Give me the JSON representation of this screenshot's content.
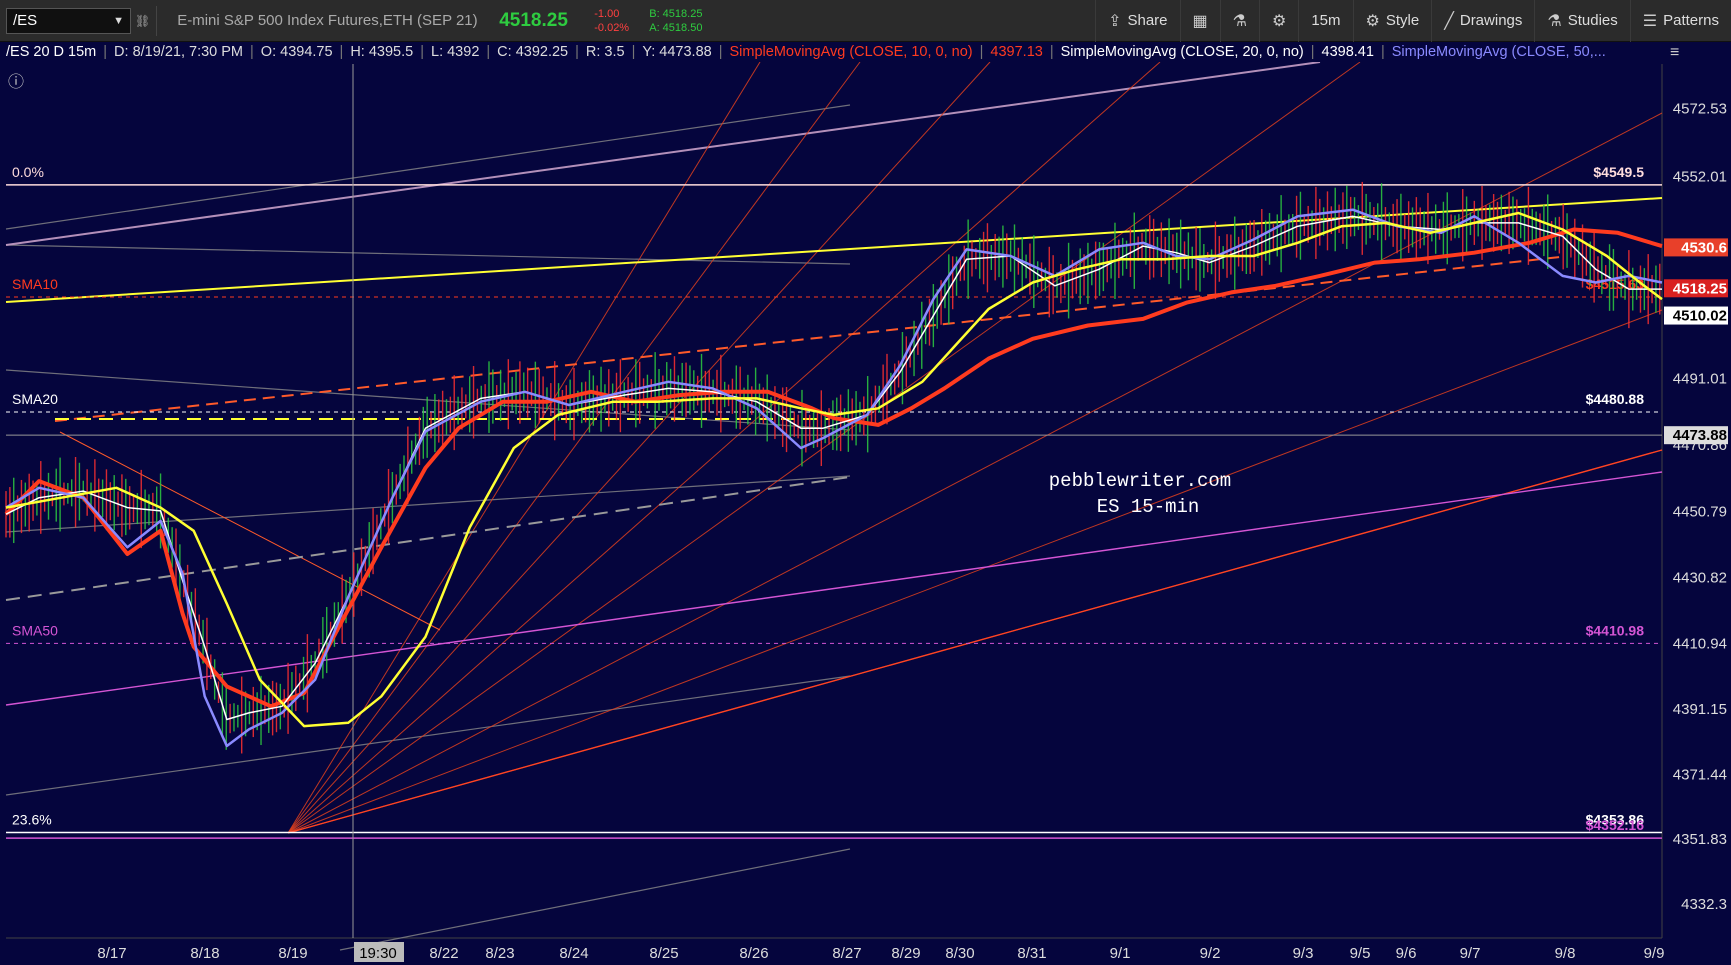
{
  "toolbar": {
    "symbol": "/ES",
    "description": "E-mini S&P 500 Index Futures,ETH (SEP 21)",
    "last": "4518.25",
    "change": "-1.00",
    "change_pct": "-0.02%",
    "bid": "B: 4518.25",
    "ask": "A: 4518.50",
    "share_label": "Share",
    "timeframe_label": "15m",
    "style_label": "Style",
    "drawings_label": "Drawings",
    "studies_label": "Studies",
    "patterns_label": "Patterns"
  },
  "info": {
    "chart_id": "/ES 20 D 15m",
    "date": "D: 8/19/21, 7:30 PM",
    "open": "O: 4394.75",
    "high": "H: 4395.5",
    "low": "L: 4392",
    "close": "C: 4392.25",
    "range": "R: 3.5",
    "cursor_y": "Y: 4473.88",
    "sma10_label": "SimpleMovingAvg (CLOSE, 10, 0, no)",
    "sma10_value": "4397.13",
    "sma20_label": "SimpleMovingAvg (CLOSE, 20, 0, no)",
    "sma20_value": "4398.41",
    "sma50_label": "SimpleMovingAvg (CLOSE, 50,..."
  },
  "colors": {
    "background": "#05053d",
    "sma10": "#ff3b1f",
    "sma20": "#ffffff",
    "sma50": "#8a8aff",
    "yellow": "#ffff33",
    "magenta": "#d455d4",
    "up": "#2ecc40",
    "down": "#ff3030"
  },
  "chart_data": {
    "type": "line",
    "watermark": [
      "pebblewriter.com",
      "ES 15-min"
    ],
    "y_ticks": [
      "4572.53",
      "4552.01",
      "4530.6",
      "4518.25",
      "4510.02",
      "4491.01",
      "4473.88",
      "4470.86",
      "4450.79",
      "4430.82",
      "4410.94",
      "4391.15",
      "4371.44",
      "4351.83",
      "4332.3"
    ],
    "y_range": [
      4322,
      4586
    ],
    "x_ticks": [
      "8/17",
      "8/18",
      "8/19",
      "19:30",
      "8/22",
      "8/23",
      "8/24",
      "8/25",
      "8/26",
      "8/27",
      "8/29",
      "8/30",
      "8/31",
      "9/1",
      "9/2",
      "9/3",
      "9/5",
      "9/6",
      "9/7",
      "9/8",
      "9/9"
    ],
    "levels": [
      {
        "label_left": "0.0%",
        "label_right": "$4549.5",
        "value": 4549.5,
        "color": "#ffdddd",
        "dash": false
      },
      {
        "label_left": "SMA10",
        "label_right": "$4515.63",
        "value": 4515.63,
        "color": "#ff3b1f",
        "dash": true
      },
      {
        "label_left": "SMA20",
        "label_right": "$4480.88",
        "value": 4480.88,
        "color": "#ffffff",
        "dash": true
      },
      {
        "label_left": "SMA50",
        "label_right": "$4410.98",
        "value": 4410.98,
        "color": "#d455d4",
        "dash": true
      },
      {
        "label_left": "23.6%",
        "label_right": "$4353.86",
        "value": 4353.86,
        "color": "#ffffff",
        "dash": false
      },
      {
        "label_left": "",
        "label_right": "$4352.16",
        "value": 4352.16,
        "color": "#d455d4",
        "dash": false
      }
    ],
    "price_tags": [
      {
        "text": "4530.6",
        "value": 4530.6,
        "bg": "#e8402a",
        "fg": "#ffffff"
      },
      {
        "text": "4518.25",
        "value": 4518.25,
        "bg": "#d92020",
        "fg": "#ffffff"
      },
      {
        "text": "4510.02",
        "value": 4510.02,
        "bg": "#ffffff",
        "fg": "#000000"
      },
      {
        "text": "4473.88",
        "value": 4473.88,
        "bg": "#dddddd",
        "fg": "#000000"
      }
    ],
    "series": [
      {
        "name": "SMA10",
        "values": [
          [
            0,
            4450
          ],
          [
            3,
            4460
          ],
          [
            7,
            4455
          ],
          [
            11,
            4438
          ],
          [
            14,
            4445
          ],
          [
            16,
            4420
          ],
          [
            17,
            4410
          ],
          [
            20,
            4398
          ],
          [
            24,
            4392
          ],
          [
            27,
            4396
          ],
          [
            30,
            4415
          ],
          [
            34,
            4440
          ],
          [
            38,
            4464
          ],
          [
            41,
            4476
          ],
          [
            45,
            4484
          ],
          [
            49,
            4484
          ],
          [
            53,
            4487
          ],
          [
            57,
            4484
          ],
          [
            61,
            4486
          ],
          [
            65,
            4487
          ],
          [
            69,
            4487
          ],
          [
            73,
            4482
          ],
          [
            75,
            4479
          ],
          [
            79,
            4477
          ],
          [
            82,
            4482
          ],
          [
            85,
            4488
          ],
          [
            89,
            4497
          ],
          [
            93,
            4503
          ],
          [
            98,
            4507
          ],
          [
            103,
            4509
          ],
          [
            107,
            4514
          ],
          [
            111,
            4517
          ],
          [
            115,
            4519
          ],
          [
            119,
            4522
          ],
          [
            124,
            4526
          ],
          [
            128,
            4527
          ],
          [
            133,
            4529
          ],
          [
            138,
            4532
          ],
          [
            142,
            4536
          ],
          [
            146,
            4535
          ],
          [
            150,
            4531
          ]
        ]
      },
      {
        "name": "SMA20",
        "values": [
          [
            0,
            4450
          ],
          [
            3,
            4455
          ],
          [
            7,
            4457
          ],
          [
            11,
            4452
          ],
          [
            14,
            4451
          ],
          [
            16,
            4430
          ],
          [
            18,
            4410
          ],
          [
            20,
            4388
          ],
          [
            22,
            4390
          ],
          [
            25,
            4392
          ],
          [
            28,
            4405
          ],
          [
            31,
            4425
          ],
          [
            35,
            4455
          ],
          [
            38,
            4476
          ],
          [
            43,
            4485
          ],
          [
            47,
            4487
          ],
          [
            51,
            4483
          ],
          [
            56,
            4486
          ],
          [
            60,
            4488
          ],
          [
            64,
            4487
          ],
          [
            68,
            4484
          ],
          [
            72,
            4476
          ],
          [
            74,
            4476
          ],
          [
            78,
            4480
          ],
          [
            81,
            4493
          ],
          [
            84,
            4510
          ],
          [
            87,
            4527
          ],
          [
            91,
            4528
          ],
          [
            95,
            4519
          ],
          [
            99,
            4524
          ],
          [
            103,
            4531
          ],
          [
            106,
            4529
          ],
          [
            109,
            4526
          ],
          [
            113,
            4531
          ],
          [
            117,
            4537
          ],
          [
            122,
            4540
          ],
          [
            126,
            4537
          ],
          [
            130,
            4536
          ],
          [
            133,
            4538
          ],
          [
            137,
            4538
          ],
          [
            141,
            4534
          ],
          [
            144,
            4524
          ],
          [
            147,
            4518
          ],
          [
            150,
            4518
          ]
        ]
      },
      {
        "name": "SMA50",
        "values": [
          [
            0,
            4452
          ],
          [
            3,
            4458
          ],
          [
            7,
            4455
          ],
          [
            11,
            4440
          ],
          [
            14,
            4448
          ],
          [
            16,
            4432
          ],
          [
            18,
            4395
          ],
          [
            20,
            4380
          ],
          [
            22,
            4385
          ],
          [
            25,
            4390
          ],
          [
            28,
            4400
          ],
          [
            31,
            4425
          ],
          [
            35,
            4455
          ],
          [
            38,
            4475
          ],
          [
            43,
            4484
          ],
          [
            47,
            4487
          ],
          [
            51,
            4483
          ],
          [
            56,
            4487
          ],
          [
            60,
            4490
          ],
          [
            64,
            4488
          ],
          [
            68,
            4482
          ],
          [
            72,
            4470
          ],
          [
            74,
            4473
          ],
          [
            78,
            4480
          ],
          [
            81,
            4495
          ],
          [
            84,
            4515
          ],
          [
            87,
            4530
          ],
          [
            91,
            4528
          ],
          [
            95,
            4522
          ],
          [
            99,
            4530
          ],
          [
            103,
            4532
          ],
          [
            106,
            4528
          ],
          [
            109,
            4527
          ],
          [
            113,
            4533
          ],
          [
            117,
            4540
          ],
          [
            122,
            4542
          ],
          [
            126,
            4537
          ],
          [
            130,
            4535
          ],
          [
            133,
            4540
          ],
          [
            137,
            4532
          ],
          [
            141,
            4522
          ],
          [
            144,
            4520
          ],
          [
            147,
            4522
          ],
          [
            150,
            4520
          ]
        ]
      },
      {
        "name": "Yellow MA",
        "values": [
          [
            0,
            4452
          ],
          [
            5,
            4455
          ],
          [
            10,
            4458
          ],
          [
            14,
            4452
          ],
          [
            17,
            4445
          ],
          [
            20,
            4423
          ],
          [
            23,
            4400
          ],
          [
            27,
            4386
          ],
          [
            31,
            4387
          ],
          [
            34,
            4395
          ],
          [
            38,
            4413
          ],
          [
            42,
            4446
          ],
          [
            46,
            4470
          ],
          [
            50,
            4480
          ],
          [
            55,
            4484
          ],
          [
            59,
            4484
          ],
          [
            64,
            4485
          ],
          [
            68,
            4485
          ],
          [
            72,
            4482
          ],
          [
            75,
            4480
          ],
          [
            79,
            4482
          ],
          [
            83,
            4490
          ],
          [
            86,
            4501
          ],
          [
            89,
            4512
          ],
          [
            93,
            4520
          ],
          [
            97,
            4524
          ],
          [
            101,
            4527
          ],
          [
            105,
            4527
          ],
          [
            109,
            4528
          ],
          [
            113,
            4528
          ],
          [
            117,
            4532
          ],
          [
            121,
            4537
          ],
          [
            125,
            4538
          ],
          [
            129,
            4535
          ],
          [
            133,
            4538
          ],
          [
            137,
            4541
          ],
          [
            141,
            4536
          ],
          [
            145,
            4528
          ],
          [
            148,
            4520
          ],
          [
            150,
            4515
          ]
        ]
      }
    ]
  }
}
